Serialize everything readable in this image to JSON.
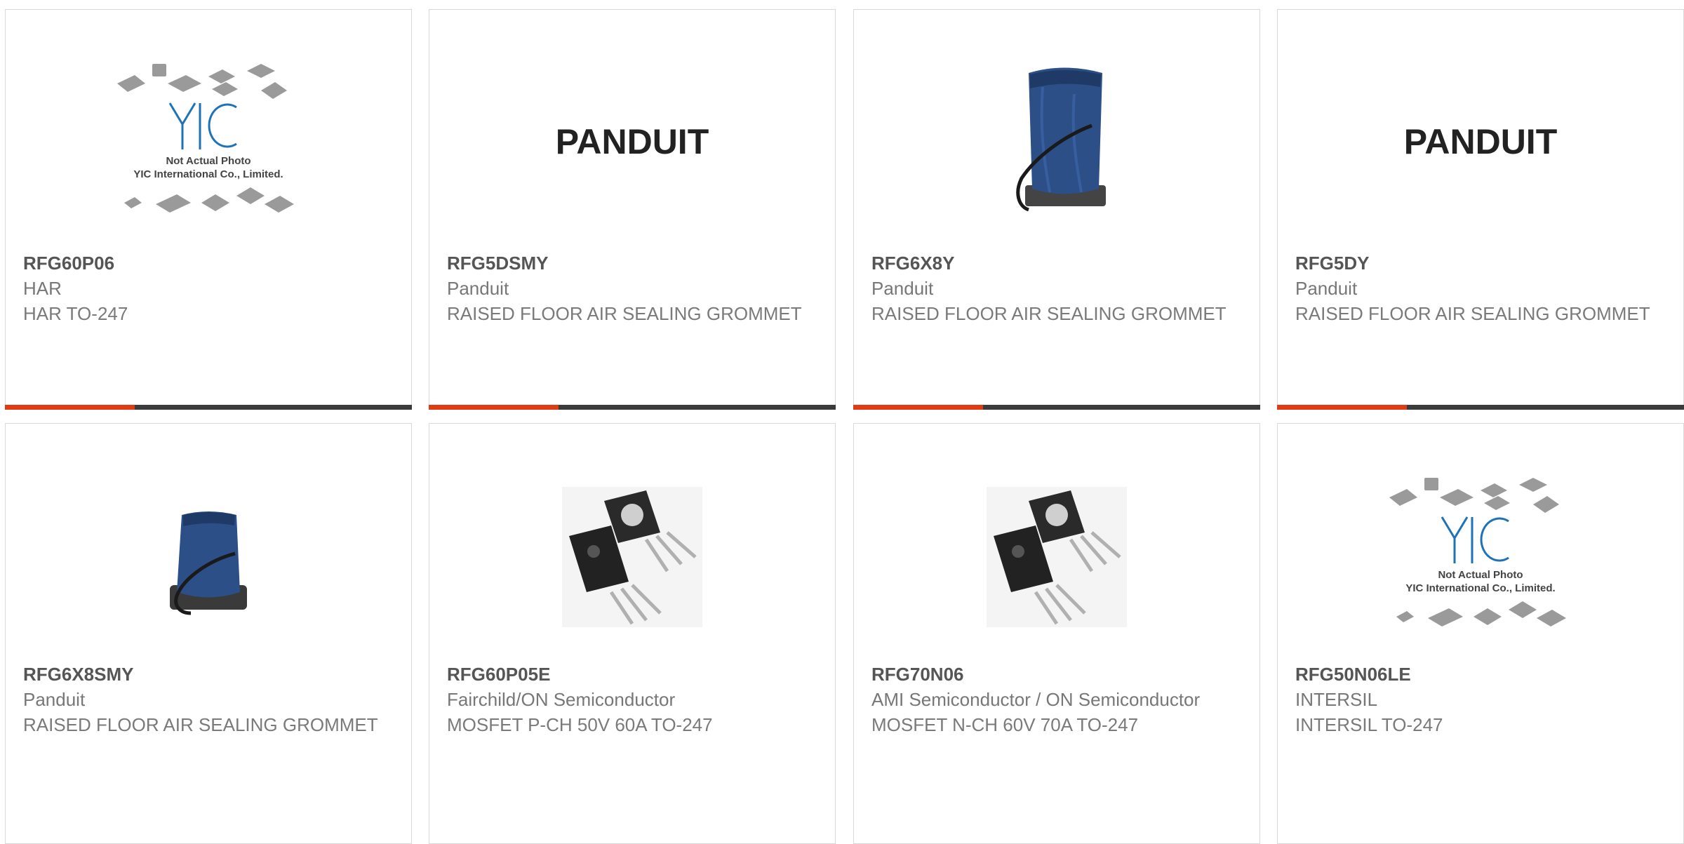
{
  "accent_color": "#e03c14",
  "products": [
    {
      "part": "RFG60P06",
      "manufacturer": "HAR",
      "description": "HAR TO-247",
      "image": "not-actual-photo-placeholder",
      "placeholder_text_1": "Not Actual Photo",
      "placeholder_text_2": "YIC International Co., Limited."
    },
    {
      "part": "RFG5DSMY",
      "manufacturer": "Panduit",
      "description": "RAISED FLOOR AIR SEALING GROMMET",
      "image": "panduit-logo",
      "logo_text": "PANDUIT"
    },
    {
      "part": "RFG6X8Y",
      "manufacturer": "Panduit",
      "description": "RAISED FLOOR AIR SEALING GROMMET",
      "image": "grommet-photo"
    },
    {
      "part": "RFG5DY",
      "manufacturer": "Panduit",
      "description": "RAISED FLOOR AIR SEALING GROMMET",
      "image": "panduit-logo",
      "logo_text": "PANDUIT"
    },
    {
      "part": "RFG6X8SMY",
      "manufacturer": "Panduit",
      "description": "RAISED FLOOR AIR SEALING GROMMET",
      "image": "grommet-photo"
    },
    {
      "part": "RFG60P05E",
      "manufacturer": "Fairchild/ON Semiconductor",
      "description": "MOSFET P-CH 50V 60A TO-247",
      "image": "to-247-transistor-photo"
    },
    {
      "part": "RFG70N06",
      "manufacturer": "AMI Semiconductor / ON Semiconductor",
      "description": "MOSFET N-CH 60V 70A TO-247",
      "image": "to-247-transistor-photo"
    },
    {
      "part": "RFG50N06LE",
      "manufacturer": "INTERSIL",
      "description": "INTERSIL TO-247",
      "image": "not-actual-photo-placeholder",
      "placeholder_text_1": "Not Actual Photo",
      "placeholder_text_2": "YIC International Co., Limited."
    }
  ]
}
